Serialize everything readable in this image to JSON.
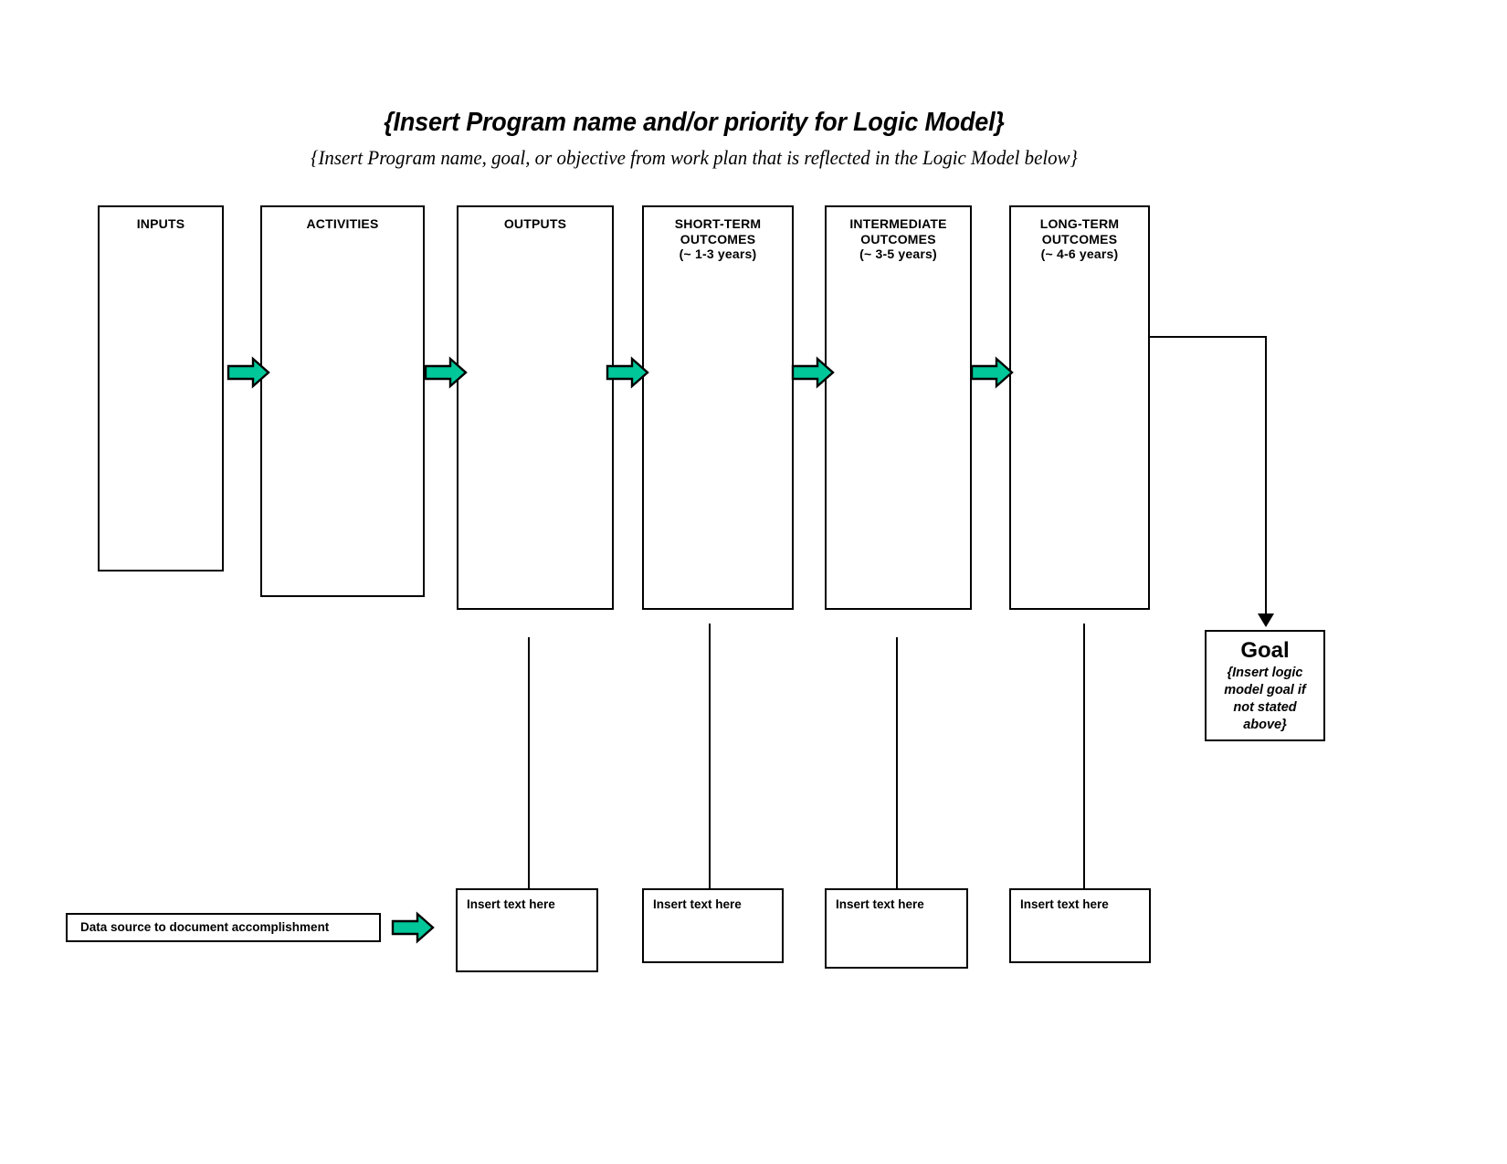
{
  "document": {
    "title": "{Insert Program name and/or priority for Logic Model}",
    "subtitle": "{Insert Program name, goal, or objective from work plan that is reflected in the Logic Model below}"
  },
  "colors": {
    "arrow_fill": "#00C79A",
    "arrow_stroke": "#000000",
    "box_stroke": "#000000",
    "background": "#ffffff"
  },
  "columns": [
    {
      "id": "inputs",
      "line1": "INPUTS",
      "line2": "",
      "line3": ""
    },
    {
      "id": "activities",
      "line1": "ACTIVITIES",
      "line2": "",
      "line3": ""
    },
    {
      "id": "outputs",
      "line1": "OUTPUTS",
      "line2": "",
      "line3": ""
    },
    {
      "id": "short-term-outcomes",
      "line1": "SHORT-TERM",
      "line2": "OUTCOMES",
      "line3": "(~ 1-3 years)"
    },
    {
      "id": "intermediate-outcomes",
      "line1": "INTERMEDIATE",
      "line2": "OUTCOMES",
      "line3": "(~ 3-5 years)"
    },
    {
      "id": "long-term-outcomes",
      "line1": "LONG-TERM",
      "line2": "OUTCOMES",
      "line3": "(~ 4-6 years)"
    }
  ],
  "goal": {
    "heading": "Goal",
    "line1": "{Insert logic",
    "line2": "model goal if",
    "line3": "not stated",
    "line4": "above}"
  },
  "data_source": {
    "label": "Data source to document accomplishment"
  },
  "note_boxes": [
    {
      "id": "note-outputs",
      "text": "Insert text here"
    },
    {
      "id": "note-short-term",
      "text": "Insert text here"
    },
    {
      "id": "note-intermediate",
      "text": "Insert text here"
    },
    {
      "id": "note-long-term",
      "text": "Insert text here"
    }
  ],
  "arrows": {
    "flow_arrow_label": "flow-arrow",
    "count": 6
  }
}
